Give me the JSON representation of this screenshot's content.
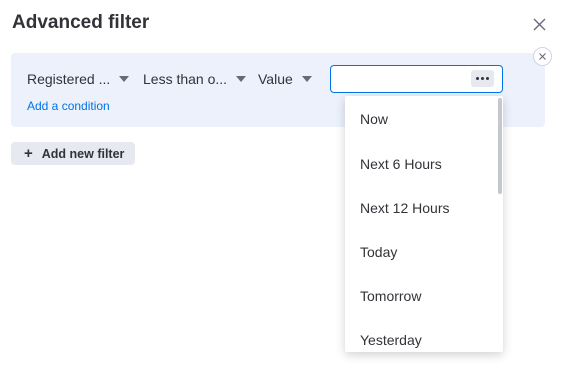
{
  "dialog": {
    "title": "Advanced filter"
  },
  "filter": {
    "column_select": "Registered ...",
    "condition_select": "Less than o...",
    "value_type_select": "Value",
    "value_input": "",
    "add_condition": "Add a condition"
  },
  "add_filter": {
    "label": "Add new filter"
  },
  "dropdown": {
    "options": [
      "Now",
      "Next 6 Hours",
      "Next 12 Hours",
      "Today",
      "Tomorrow",
      "Yesterday"
    ]
  },
  "colors": {
    "accent": "#0073ea",
    "panel": "#ecf1fb",
    "text": "#323338"
  },
  "icons": {
    "close": "close-icon",
    "remove_group": "close-icon",
    "more": "ellipsis-icon",
    "plus": "plus-icon",
    "caret": "caret-down-icon"
  }
}
